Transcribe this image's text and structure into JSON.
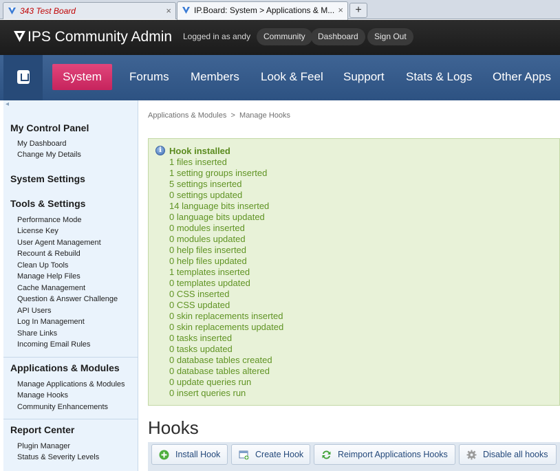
{
  "browser": {
    "tabs": [
      {
        "title": "343 Test Board",
        "active": false
      },
      {
        "title": "IP.Board: System > Applications & M...",
        "active": true
      }
    ],
    "close_glyph": "×",
    "new_tab_glyph": "+"
  },
  "admin_bar": {
    "brand": "IPS Community Admin",
    "logged_in": "Logged in as andy",
    "buttons": [
      "Community",
      "Dashboard",
      "Sign Out"
    ]
  },
  "main_nav": {
    "home_icon": "ips-logo-icon",
    "items": [
      "System",
      "Forums",
      "Members",
      "Look & Feel",
      "Support",
      "Stats & Logs",
      "Other Apps"
    ],
    "active": "System",
    "active_color": "#d63169"
  },
  "sidebar": {
    "back_glyph": "◂",
    "sections": [
      {
        "title": "My Control Panel",
        "items": [
          "My Dashboard",
          "Change My Details"
        ]
      },
      {
        "title": "System Settings",
        "items": []
      },
      {
        "title": "Tools & Settings",
        "items": [
          "Performance Mode",
          "License Key",
          "User Agent Management",
          "Recount & Rebuild",
          "Clean Up Tools",
          "Manage Help Files",
          "Cache Management",
          "Question & Answer Challenge",
          "API Users",
          "Log In Management",
          "Share Links",
          "Incoming Email Rules"
        ]
      },
      {
        "title": "Applications & Modules",
        "items": [
          "Manage Applications & Modules",
          "Manage Hooks",
          "Community Enhancements"
        ]
      },
      {
        "title": "Report Center",
        "items": [
          "Plugin Manager",
          "Status & Severity Levels"
        ]
      }
    ]
  },
  "breadcrumb": {
    "items": [
      "Applications & Modules",
      "Manage Hooks"
    ],
    "separator": ">"
  },
  "message": {
    "icon": "info-icon",
    "title": "Hook installed",
    "lines": [
      "1 files inserted",
      "1 setting groups inserted",
      "5 settings inserted",
      "0 settings updated",
      "14 language bits inserted",
      "0 language bits updated",
      "0 modules inserted",
      "0 modules updated",
      "0 help files inserted",
      "0 help files updated",
      "1 templates inserted",
      "0 templates updated",
      "0 CSS inserted",
      "0 CSS updated",
      "0 skin replacements inserted",
      "0 skin replacements updated",
      "0 tasks inserted",
      "0 tasks updated",
      "0 database tables created",
      "0 database tables altered",
      "0 update queries run",
      "0 insert queries run"
    ],
    "text_color": "#5f9323",
    "bg_color": "#e8f2d8"
  },
  "hooks": {
    "title": "Hooks",
    "buttons": [
      {
        "label": "Install Hook",
        "icon": "add-icon"
      },
      {
        "label": "Create Hook",
        "icon": "create-window-icon"
      },
      {
        "label": "Reimport Applications Hooks",
        "icon": "refresh-icon"
      },
      {
        "label": "Disable all hooks",
        "icon": "gear-icon"
      }
    ]
  }
}
